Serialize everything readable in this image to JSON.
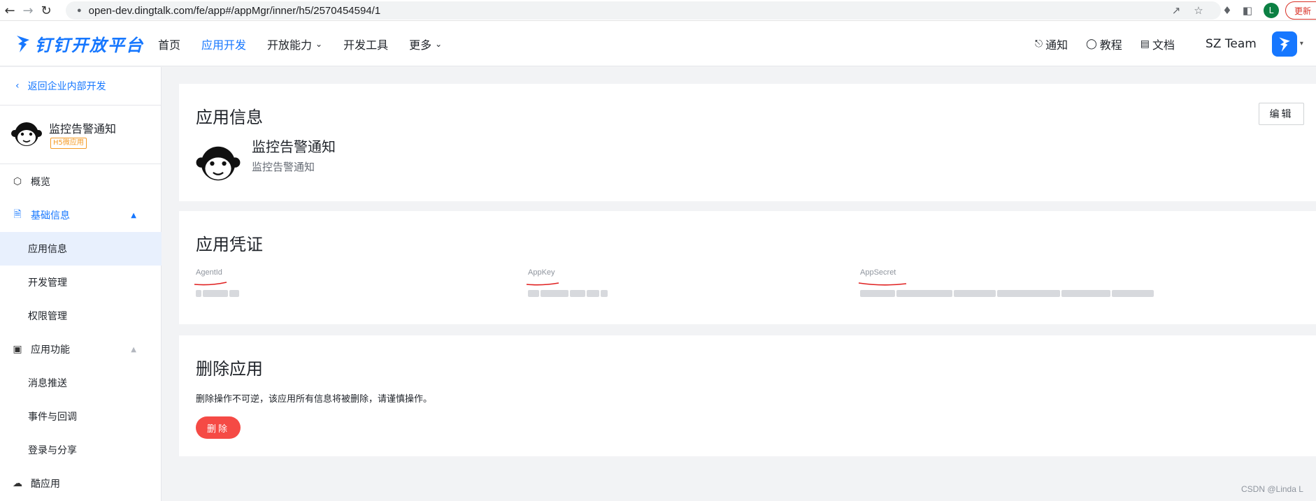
{
  "browser": {
    "url": "open-dev.dingtalk.com/fe/app#/appMgr/inner/h5/2570454594/1",
    "profile_initial": "L",
    "update_label": "更新"
  },
  "header": {
    "logo_text": "钉钉开放平台",
    "nav": [
      {
        "label": "首页",
        "active": false,
        "dropdown": false
      },
      {
        "label": "应用开发",
        "active": true,
        "dropdown": false
      },
      {
        "label": "开放能力",
        "active": false,
        "dropdown": true
      },
      {
        "label": "开发工具",
        "active": false,
        "dropdown": false
      },
      {
        "label": "更多",
        "active": false,
        "dropdown": true
      }
    ],
    "right": {
      "notify": "通知",
      "tutorial": "教程",
      "docs": "文档",
      "team": "SZ Team"
    },
    "accent": "#1677ff"
  },
  "sidebar": {
    "back_label": "返回企业内部开发",
    "app_name": "监控告警通知",
    "app_badge": "H5微应用",
    "menu": [
      {
        "label": "概览",
        "level": "top",
        "icon": "cube-icon"
      },
      {
        "label": "基础信息",
        "level": "top",
        "icon": "document-icon",
        "expanded": true
      },
      {
        "label": "应用信息",
        "level": "sub",
        "selected": true
      },
      {
        "label": "开发管理",
        "level": "sub"
      },
      {
        "label": "权限管理",
        "level": "sub"
      },
      {
        "label": "应用功能",
        "level": "top",
        "icon": "app-function-icon",
        "expanded": true
      },
      {
        "label": "消息推送",
        "level": "sub"
      },
      {
        "label": "事件与回调",
        "level": "sub"
      },
      {
        "label": "登录与分享",
        "level": "sub"
      },
      {
        "label": "酷应用",
        "level": "top",
        "icon": "cool-app-icon"
      }
    ]
  },
  "main": {
    "info": {
      "title": "应用信息",
      "edit_label": "编辑",
      "app_name": "监控告警通知",
      "app_desc": "监控告警通知"
    },
    "credentials": {
      "title": "应用凭证",
      "agent_id_label": "AgentId",
      "app_key_label": "AppKey",
      "app_secret_label": "AppSecret"
    },
    "delete": {
      "title": "删除应用",
      "warning": "删除操作不可逆，该应用所有信息将被删除，请谨慎操作。",
      "button_label": "删除",
      "button_color": "#f54a45"
    }
  },
  "watermark": "CSDN @Linda L"
}
